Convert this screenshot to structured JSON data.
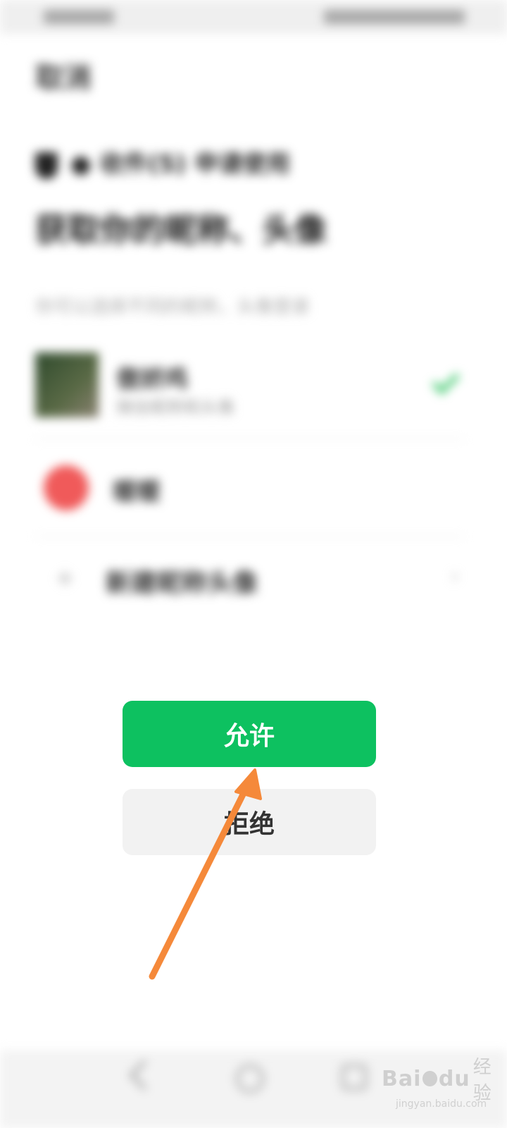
{
  "background": {
    "cancel_label": "取消",
    "app_line": "● 收件(5) 申请使用",
    "heading": "获取你的昵称、头像",
    "subtext": "你可以选择不同的昵称，头像登录",
    "profiles": [
      {
        "name": "傲娇鸡",
        "desc": "微信昵称和头像"
      },
      {
        "name": "暖暖"
      }
    ],
    "new_profile_label": "新建昵称头像",
    "new_profile_plus": "+",
    "chevron": "›"
  },
  "dialog": {
    "allow_label": "允许",
    "deny_label": "拒绝"
  },
  "colors": {
    "allow_bg": "#0dc160",
    "deny_bg": "#f2f2f2",
    "arrow": "#f5893a"
  },
  "watermark": {
    "logo": "Bai",
    "logo_suffix": "du",
    "text": "经验",
    "url": "jingyan.baidu.com"
  }
}
